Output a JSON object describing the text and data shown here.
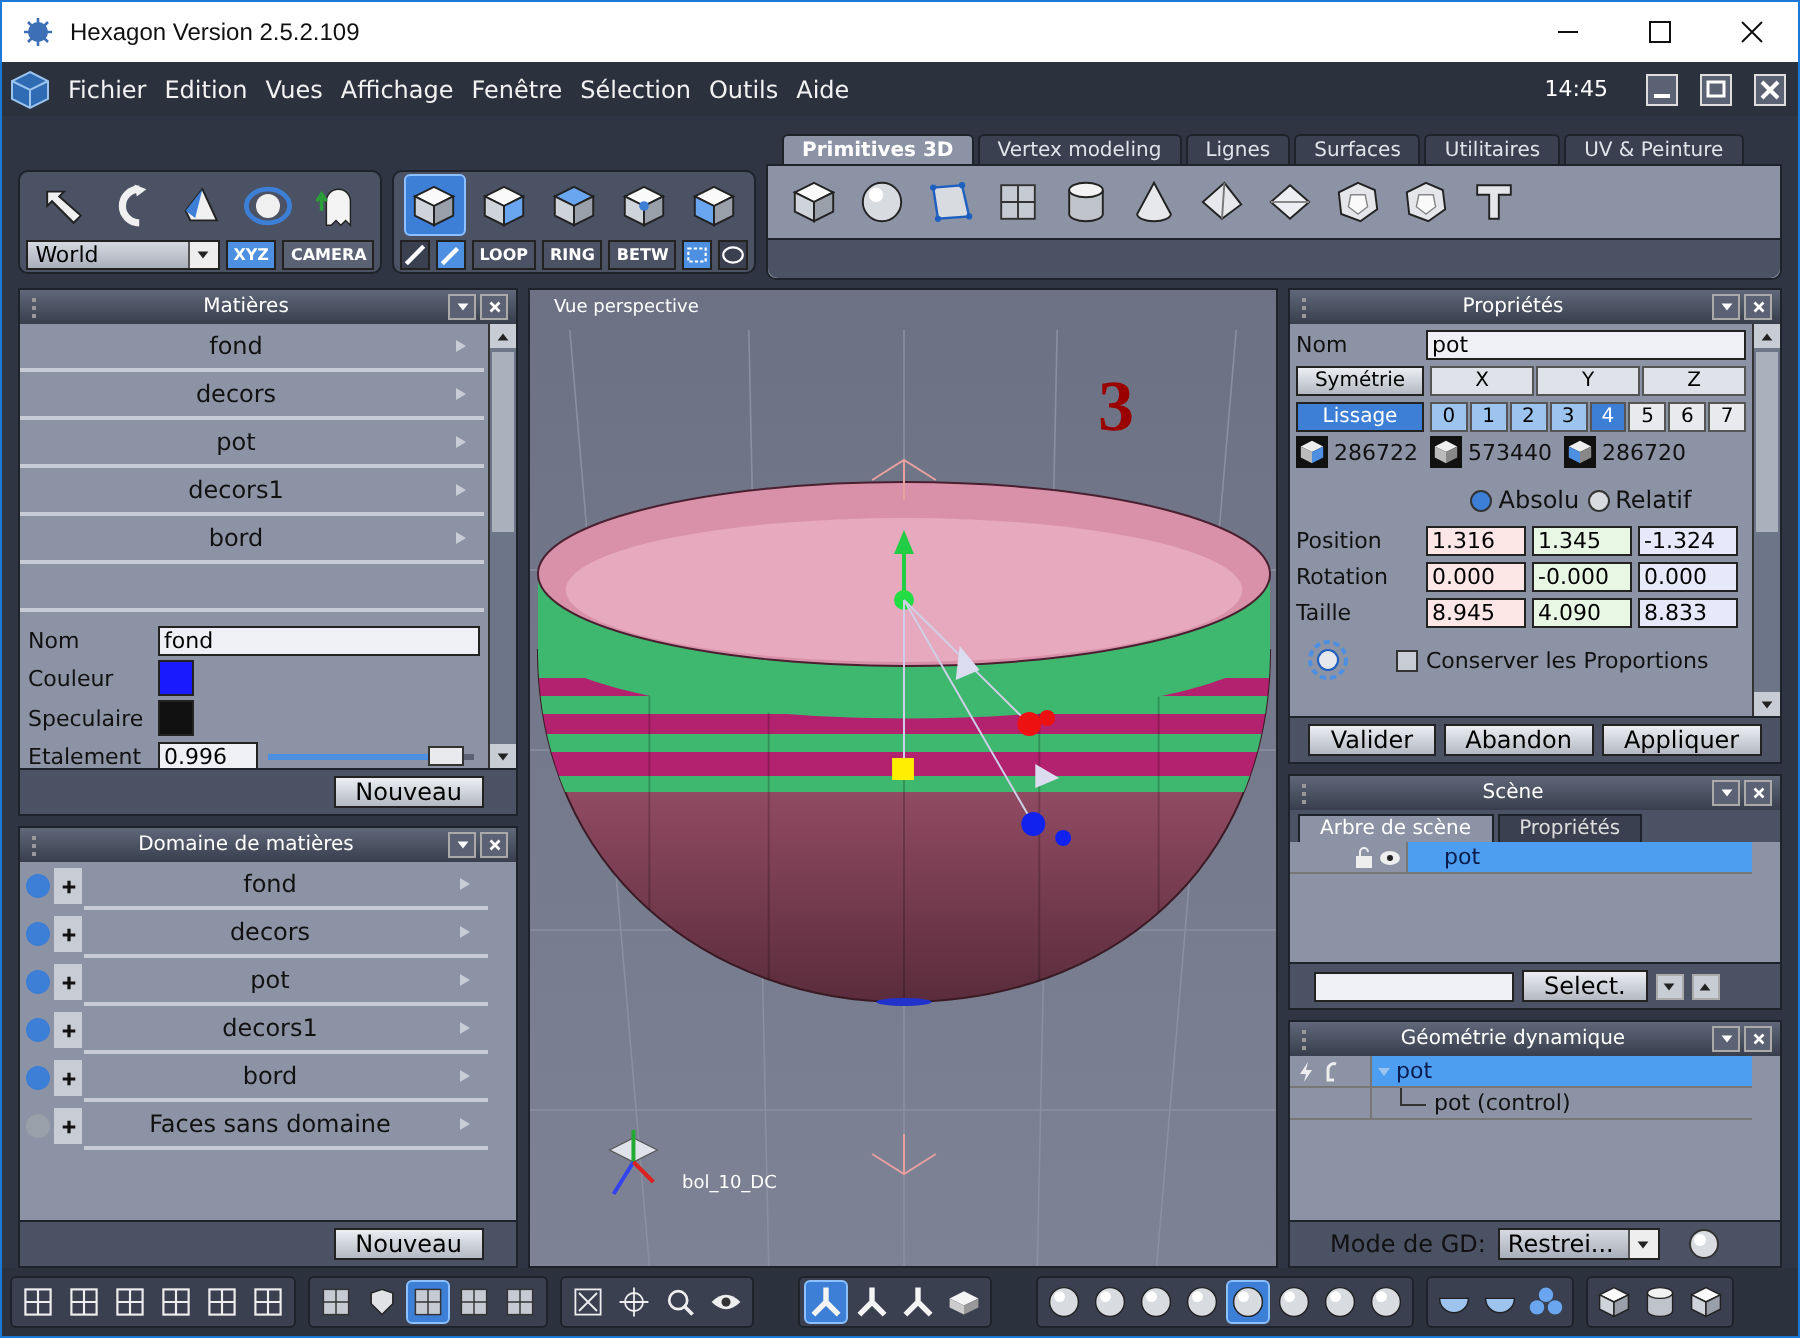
{
  "window": {
    "title": "Hexagon Version 2.5.2.109"
  },
  "menu": {
    "items": [
      "Fichier",
      "Edition",
      "Vues",
      "Affichage",
      "Fenêtre",
      "Sélection",
      "Outils",
      "Aide"
    ],
    "clock": "14:45"
  },
  "toolbar": {
    "space": "World",
    "axis_modes": [
      {
        "label": "XYZ",
        "selected": true
      },
      {
        "label": "CAMERA",
        "selected": false
      }
    ],
    "select_tools": [
      {
        "selected": true
      },
      {
        "selected": false
      },
      {
        "selected": false
      },
      {
        "selected": false
      },
      {
        "selected": false
      }
    ],
    "edge_modes": [
      "LOOP",
      "RING",
      "BETW"
    ],
    "tabs": [
      {
        "label": "Primitives 3D",
        "selected": true
      },
      {
        "label": "Vertex modeling",
        "selected": false
      },
      {
        "label": "Lignes",
        "selected": false
      },
      {
        "label": "Surfaces",
        "selected": false
      },
      {
        "label": "Utilitaires",
        "selected": false
      },
      {
        "label": "UV & Peinture",
        "selected": false
      }
    ]
  },
  "materials": {
    "title": "Matières",
    "items": [
      "fond",
      "decors",
      "pot",
      "decors1",
      "bord"
    ],
    "name_label": "Nom",
    "name": "fond",
    "swatches": [
      {
        "label": "Couleur",
        "color": "#1a1aff"
      },
      {
        "label": "Speculaire",
        "color": "#111111"
      }
    ],
    "spread": {
      "label": "Etalement",
      "value": "0.996",
      "level": 0.95
    },
    "button": "Nouveau"
  },
  "domains": {
    "title": "Domaine de matières",
    "items": [
      {
        "label": "fond",
        "color": "#3d7fd6"
      },
      {
        "label": "decors",
        "color": "#3d7fd6"
      },
      {
        "label": "pot",
        "color": "#3d7fd6"
      },
      {
        "label": "decors1",
        "color": "#3d7fd6"
      },
      {
        "label": "bord",
        "color": "#3d7fd6"
      },
      {
        "label": "Faces sans domaine",
        "color": "#9aa0aa"
      }
    ],
    "button": "Nouveau"
  },
  "viewport": {
    "title": "Vue perspective",
    "marker": "3",
    "object_label": "bol_10_DC"
  },
  "properties": {
    "title": "Propriétés",
    "name_label": "Nom",
    "name": "pot",
    "toggles": [
      {
        "label": "Symétrie",
        "on": false
      },
      {
        "label": "Lissage",
        "on": true
      }
    ],
    "axes": [
      "X",
      "Y",
      "Z"
    ],
    "smoothing": [
      {
        "label": "0",
        "selected": false
      },
      {
        "label": "1",
        "selected": false
      },
      {
        "label": "2",
        "selected": false
      },
      {
        "label": "3",
        "selected": false
      },
      {
        "label": "4",
        "selected": true
      },
      {
        "label": "5",
        "selected": false
      },
      {
        "label": "6",
        "selected": false
      },
      {
        "label": "7",
        "selected": false
      }
    ],
    "stats": [
      "286722",
      "573440",
      "286720"
    ],
    "modes": [
      {
        "label": "Absolu",
        "selected": true
      },
      {
        "label": "Relatif",
        "selected": false
      }
    ],
    "transform": [
      {
        "label": "Position",
        "values": [
          "1.316",
          "1.345",
          "-1.324"
        ]
      },
      {
        "label": "Rotation",
        "values": [
          "0.000",
          "-0.000",
          "0.000"
        ]
      },
      {
        "label": "Taille",
        "values": [
          "8.945",
          "4.090",
          "8.833"
        ]
      }
    ],
    "keep_proportions": {
      "label": "Conserver les Proportions",
      "checked": false
    },
    "buttons": [
      "Valider",
      "Abandon",
      "Appliquer"
    ]
  },
  "scene": {
    "title": "Scène",
    "tabs": [
      {
        "label": "Arbre de scène",
        "selected": true
      },
      {
        "label": "Propriétés",
        "selected": false
      }
    ],
    "tree": [
      {
        "label": "pot",
        "selected": true
      }
    ],
    "button": "Select."
  },
  "dynamic_geometry": {
    "title": "Géométrie dynamique",
    "tree": [
      {
        "label": "pot",
        "selected": true,
        "expanded": true,
        "children": [
          {
            "label": "pot (control)",
            "selected": false
          }
        ]
      }
    ],
    "mode_label": "Mode de GD:",
    "mode": "Restrei..."
  },
  "bottom_toolbar": [
    {
      "tools": [
        {
          "selected": false
        },
        {
          "selected": false
        },
        {
          "selected": false
        },
        {
          "selected": false
        },
        {
          "selected": false
        },
        {
          "selected": false
        }
      ]
    },
    {
      "tools": [
        {
          "selected": false
        },
        {
          "selected": false
        },
        {
          "selected": true
        },
        {
          "selected": false
        },
        {
          "selected": false
        }
      ]
    },
    {
      "tools": [
        {
          "selected": false
        },
        {
          "selected": false
        },
        {
          "selected": false
        },
        {
          "selected": false
        }
      ]
    },
    {
      "tools": [
        {
          "selected": true
        },
        {
          "selected": false
        },
        {
          "selected": false
        },
        {
          "selected": false
        }
      ]
    },
    {
      "tools": [
        {
          "selected": false
        },
        {
          "selected": false
        },
        {
          "selected": false
        },
        {
          "selected": false
        },
        {
          "selected": true
        },
        {
          "selected": false
        },
        {
          "selected": false
        },
        {
          "selected": false
        }
      ]
    },
    {
      "tools": [
        {
          "selected": false
        },
        {
          "selected": false
        },
        {
          "selected": false
        }
      ]
    },
    {
      "tools": [
        {
          "selected": false
        },
        {
          "selected": false
        },
        {
          "selected": false
        }
      ]
    }
  ]
}
